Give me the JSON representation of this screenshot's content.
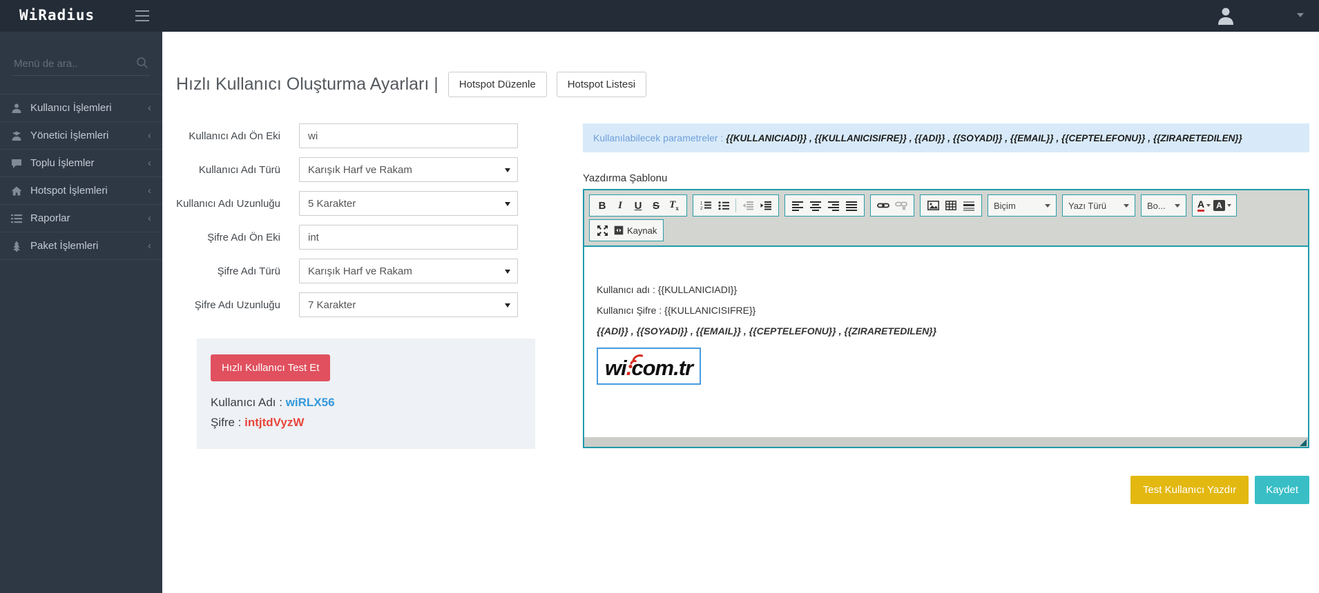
{
  "app": {
    "title": "WiRadius"
  },
  "sidebar": {
    "search_placeholder": "Menü de ara..",
    "items": [
      {
        "label": "Kullanıcı İşlemleri",
        "icon": "user-icon"
      },
      {
        "label": "Yönetici İşlemleri",
        "icon": "user-secret-icon"
      },
      {
        "label": "Toplu İşlemler",
        "icon": "comment-icon"
      },
      {
        "label": "Hotspot İşlemleri",
        "icon": "home-icon"
      },
      {
        "label": "Raporlar",
        "icon": "list-icon"
      },
      {
        "label": "Paket İşlemleri",
        "icon": "tree-icon"
      }
    ],
    "collapse_glyph": "‹"
  },
  "header": {
    "title": "Hızlı Kullanıcı Oluşturma Ayarları |",
    "buttons": [
      "Hotspot Düzenle",
      "Hotspot Listesi"
    ]
  },
  "form": {
    "fields": [
      {
        "label": "Kullanıcı Adı Ön Eki",
        "type": "text",
        "value": "wi"
      },
      {
        "label": "Kullanıcı Adı Türü",
        "type": "select",
        "value": "Karışık Harf ve Rakam"
      },
      {
        "label": "Kullanıcı Adı Uzunluğu",
        "type": "select",
        "value": "5 Karakter"
      },
      {
        "label": "Şifre Adı Ön Eki",
        "type": "text",
        "value": "int"
      },
      {
        "label": "Şifre Adı Türü",
        "type": "select",
        "value": "Karışık Harf ve Rakam"
      },
      {
        "label": "Şifre Adı Uzunluğu",
        "type": "select",
        "value": "7 Karakter"
      }
    ]
  },
  "test_box": {
    "button_label": "Hızlı Kullanıcı Test Et",
    "username_label": "Kullanıcı Adı :",
    "username_value": "wiRLX56",
    "password_label": "Şifre :",
    "password_value": "intjtdVyzW"
  },
  "parameters_banner": {
    "prefix": "Kullanılabilecek parametreler :",
    "params": "{{KULLANICIADI}} , {{KULLANICISIFRE}} , {{ADI}} , {{SOYADI}} , {{EMAIL}} , {{CEPTELEFONU}} , {{ZIRARETEDILEN}}"
  },
  "editor": {
    "label": "Yazdırma Şablonu",
    "toolbar": {
      "bold": "B",
      "italic": "I",
      "underline": "U",
      "strike": "S",
      "remove_format_main": "T",
      "remove_format_sub": "x",
      "format_dropdown": "Biçim",
      "font_dropdown": "Yazı Türü",
      "size_dropdown": "Bo...",
      "text_color_letter": "A",
      "bg_color_letter": "A",
      "source_label": "Kaynak"
    },
    "content": {
      "line1": "Kullanıcı adı : {{KULLANICIADI}}",
      "line2": "Kullanıcı Şifre : {{KULLANICISIFRE}}",
      "line3": "{{ADI}} , {{SOYADI}} , {{EMAIL}} , {{CEPTELEFONU}} , {{ZIRARETEDILEN}}",
      "logo_pre": "wi",
      "logo_dot": ".",
      "logo_post": "com.tr"
    }
  },
  "actions": {
    "print_test": "Test Kullanıcı Yazdır",
    "save": "Kaydet"
  },
  "colors": {
    "topbar": "#232c37",
    "sidebar": "#2e3845",
    "accent_teal": "#1e9aa9",
    "banner_blue": "#d8eaf9",
    "button_red": "#e0505e",
    "button_yellow": "#e3b810",
    "button_cyan": "#39bec6",
    "username_blue": "#3498db",
    "password_red": "#e8463c"
  }
}
